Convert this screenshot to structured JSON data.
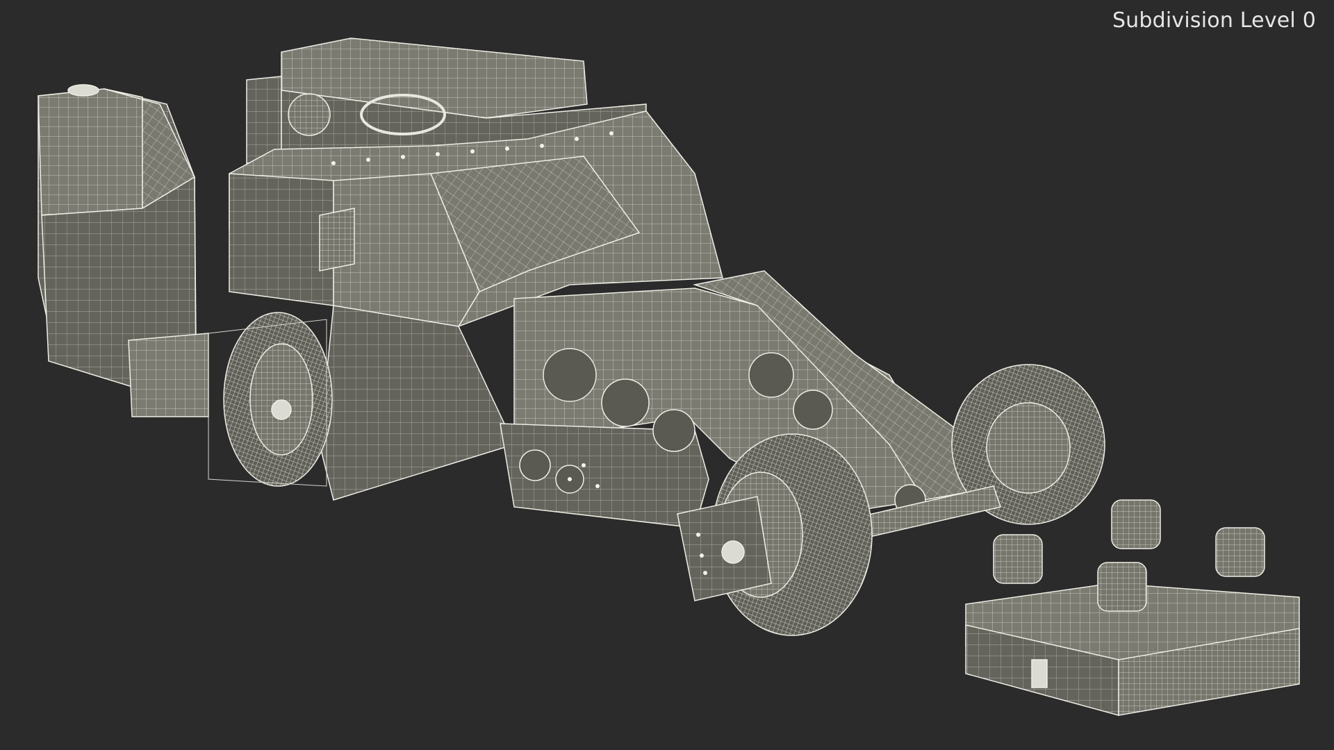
{
  "viewport": {
    "subdivision_label": "Subdivision Level 0"
  },
  "colors": {
    "background": "#2b2b2b",
    "surface": "#7c7b72",
    "surface_dark": "#5d5c55",
    "wire": "#e9e8e0"
  }
}
